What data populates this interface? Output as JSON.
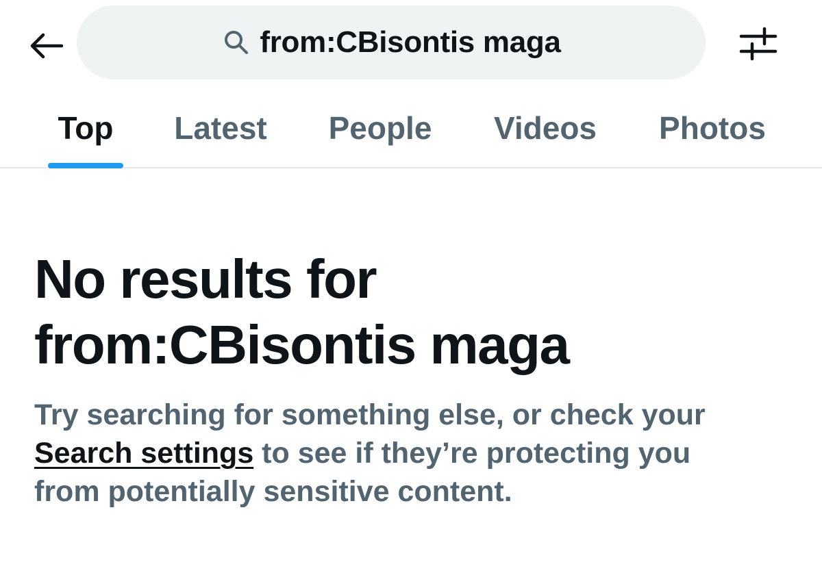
{
  "header": {
    "back_icon": "arrow-left-icon",
    "search": {
      "icon": "search-icon",
      "value": "from:CBisontis maga"
    },
    "filter_icon": "sliders-icon"
  },
  "tabs": [
    {
      "label": "Top",
      "active": true
    },
    {
      "label": "Latest",
      "active": false
    },
    {
      "label": "People",
      "active": false
    },
    {
      "label": "Videos",
      "active": false
    },
    {
      "label": "Photos",
      "active": false
    }
  ],
  "empty_state": {
    "title_line1": "No results for",
    "title_line2": "from:CBisontis maga",
    "message_line1": "Try searching for something else, or check your",
    "link_label": "Search settings",
    "message_line2_rest": " to see if they’re protecting you",
    "message_line3": "from potentially sensitive content."
  },
  "colors": {
    "accent": "#1d9bf0",
    "text_primary": "#0f1419",
    "text_secondary": "#536471",
    "search_bg": "#eff3f4"
  }
}
